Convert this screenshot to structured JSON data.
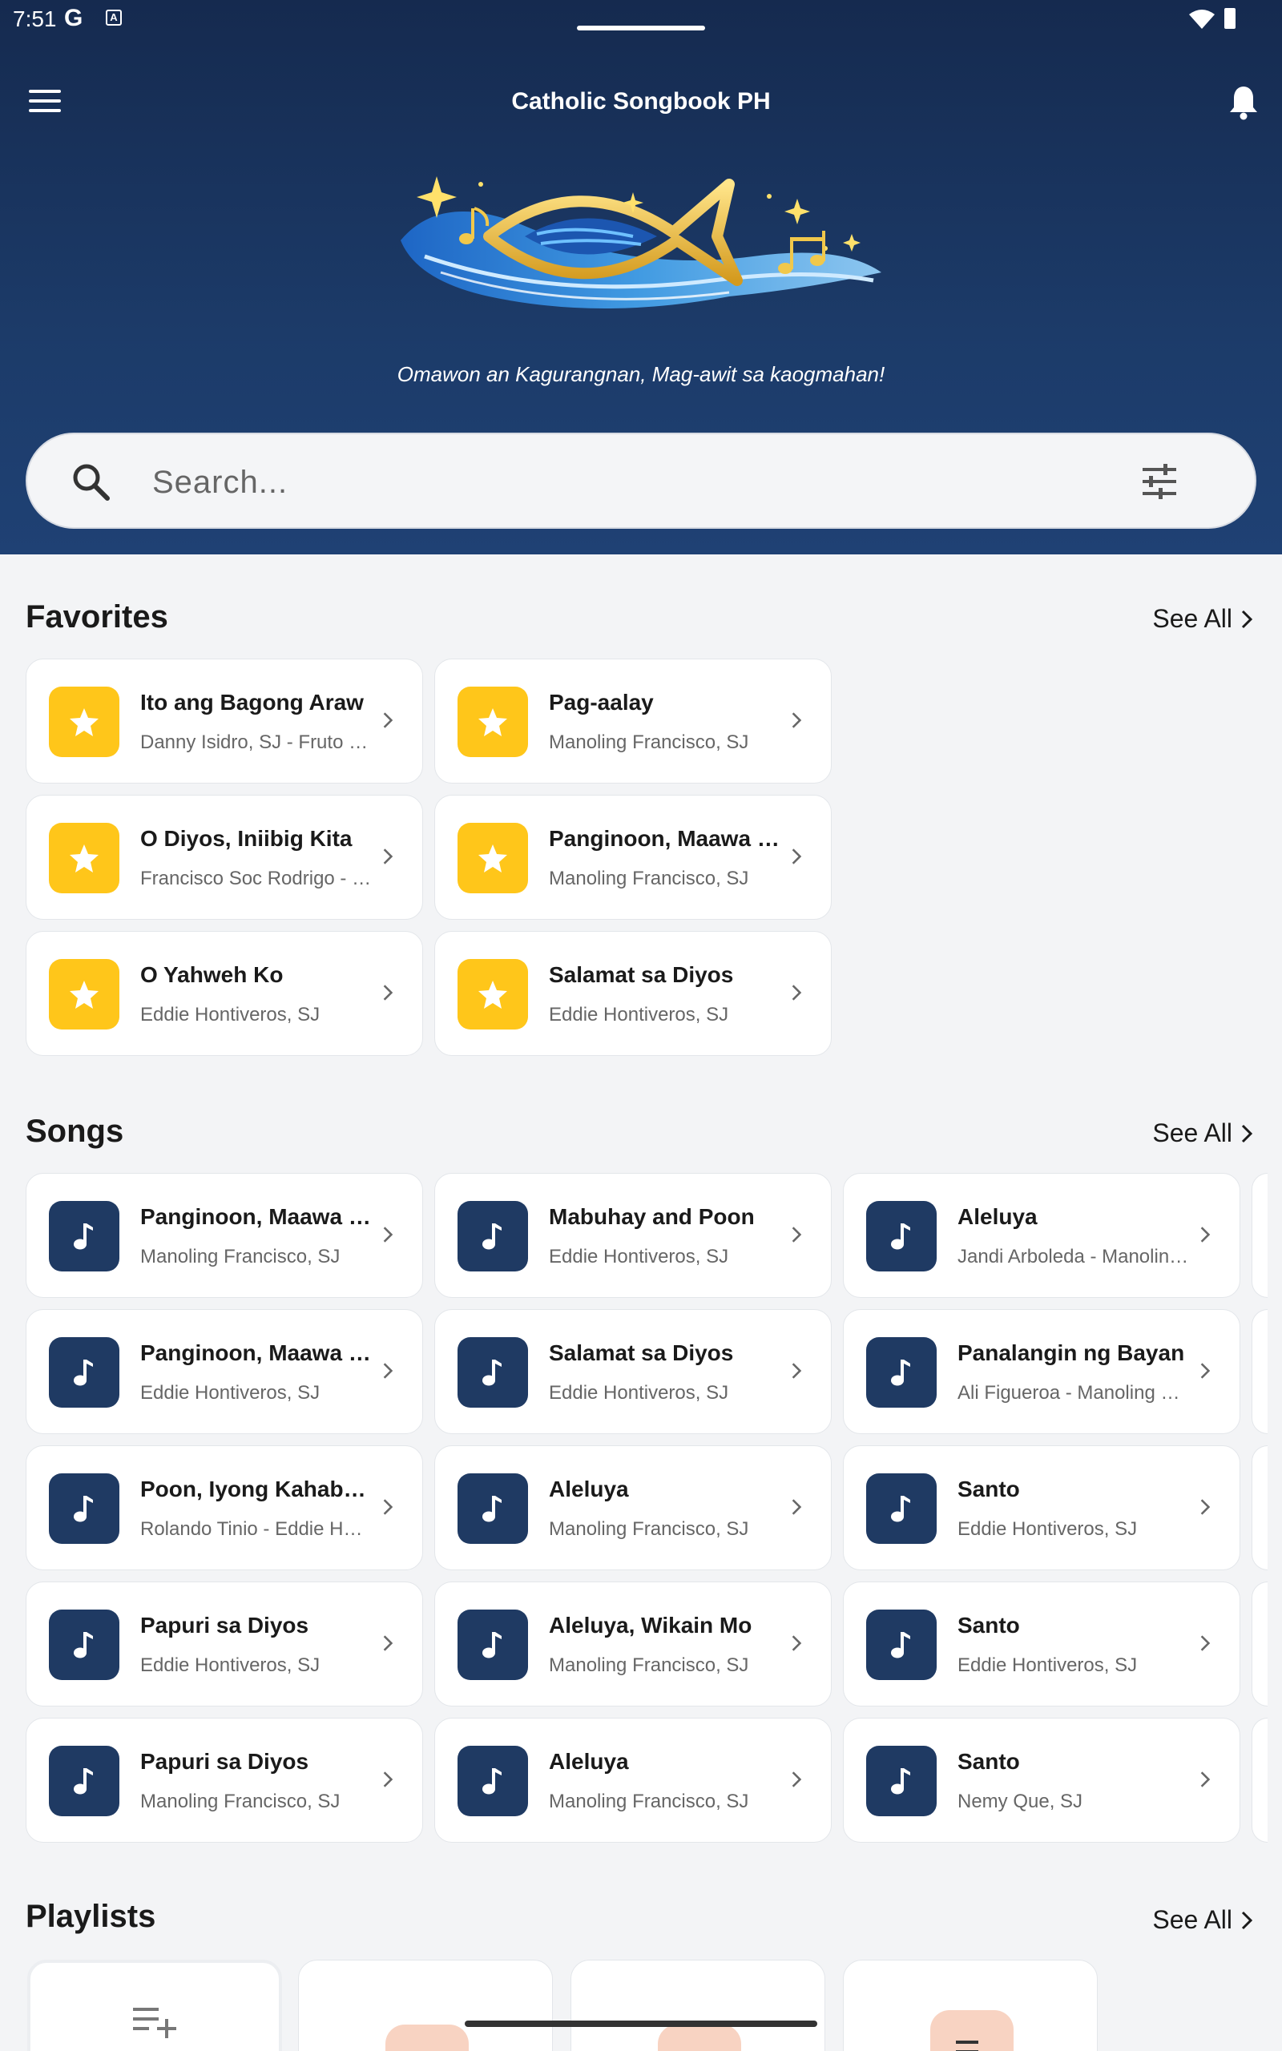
{
  "status": {
    "time": "7:51",
    "g_glyph": "G",
    "a_glyph": "A"
  },
  "header": {
    "title": "Catholic Songbook PH",
    "tagline": "Omawon an Kagurangnan, Mag-awit sa kaogmahan!"
  },
  "search": {
    "placeholder": "Search..."
  },
  "favorites": {
    "title": "Favorites",
    "see_all": "See All",
    "items": [
      {
        "title": "Ito ang Bagong Araw",
        "subtitle": "Danny Isidro, SJ - Fruto Ramirez, SJ"
      },
      {
        "title": "Pag-aalay",
        "subtitle": "Manoling Francisco, SJ"
      },
      {
        "title": "O Diyos, Iniibig Kita",
        "subtitle": "Francisco Soc Rodrigo - Eddie Hontiveros, SJ"
      },
      {
        "title": "Panginoon, Maawa Ka",
        "subtitle": "Manoling Francisco, SJ"
      },
      {
        "title": "O Yahweh Ko",
        "subtitle": "Eddie Hontiveros, SJ"
      },
      {
        "title": "Salamat sa Diyos",
        "subtitle": "Eddie Hontiveros, SJ"
      }
    ]
  },
  "songs": {
    "title": "Songs",
    "see_all": "See All",
    "items": [
      {
        "title": "Panginoon, Maawa Ka",
        "subtitle": "Manoling Francisco, SJ"
      },
      {
        "title": "Mabuhay and Poon",
        "subtitle": "Eddie Hontiveros, SJ"
      },
      {
        "title": "Aleluya",
        "subtitle": "Jandi Arboleda - Manoling Francisco, SJ"
      },
      {
        "title": "Panginoon, Maawa Ka",
        "subtitle": "Eddie Hontiveros, SJ"
      },
      {
        "title": "Salamat sa Diyos",
        "subtitle": "Eddie Hontiveros, SJ"
      },
      {
        "title": "Panalangin ng Bayan",
        "subtitle": "Ali Figueroa - Manoling Francisco, SJ"
      },
      {
        "title": "Poon, Iyong Kahabagan",
        "subtitle": "Rolando Tinio - Eddie Hontiveros, SJ"
      },
      {
        "title": "Aleluya",
        "subtitle": "Manoling Francisco, SJ"
      },
      {
        "title": "Santo",
        "subtitle": "Eddie Hontiveros, SJ"
      },
      {
        "title": "Papuri sa Diyos",
        "subtitle": "Eddie Hontiveros, SJ"
      },
      {
        "title": "Aleluya, Wikain Mo",
        "subtitle": "Manoling Francisco, SJ"
      },
      {
        "title": "Santo",
        "subtitle": "Eddie Hontiveros, SJ"
      },
      {
        "title": "Papuri sa Diyos",
        "subtitle": "Manoling Francisco, SJ"
      },
      {
        "title": "Aleluya",
        "subtitle": "Manoling Francisco, SJ"
      },
      {
        "title": "Santo",
        "subtitle": "Nemy Que, SJ"
      }
    ]
  },
  "playlists": {
    "title": "Playlists",
    "see_all": "See All"
  },
  "icons": {
    "menu": "menu-icon",
    "bell": "bell-icon",
    "search": "search-icon",
    "filter": "tune-icon",
    "favorite": "star-icon",
    "song": "music-note-icon",
    "chevron": "chevron-right-icon",
    "add_playlist": "playlist-add-icon"
  },
  "colors": {
    "hero": "#1c3b69",
    "favorite_badge": "#ffc61a",
    "song_badge": "#1f3a63",
    "playlist_thumb": "#f8d3c2"
  }
}
